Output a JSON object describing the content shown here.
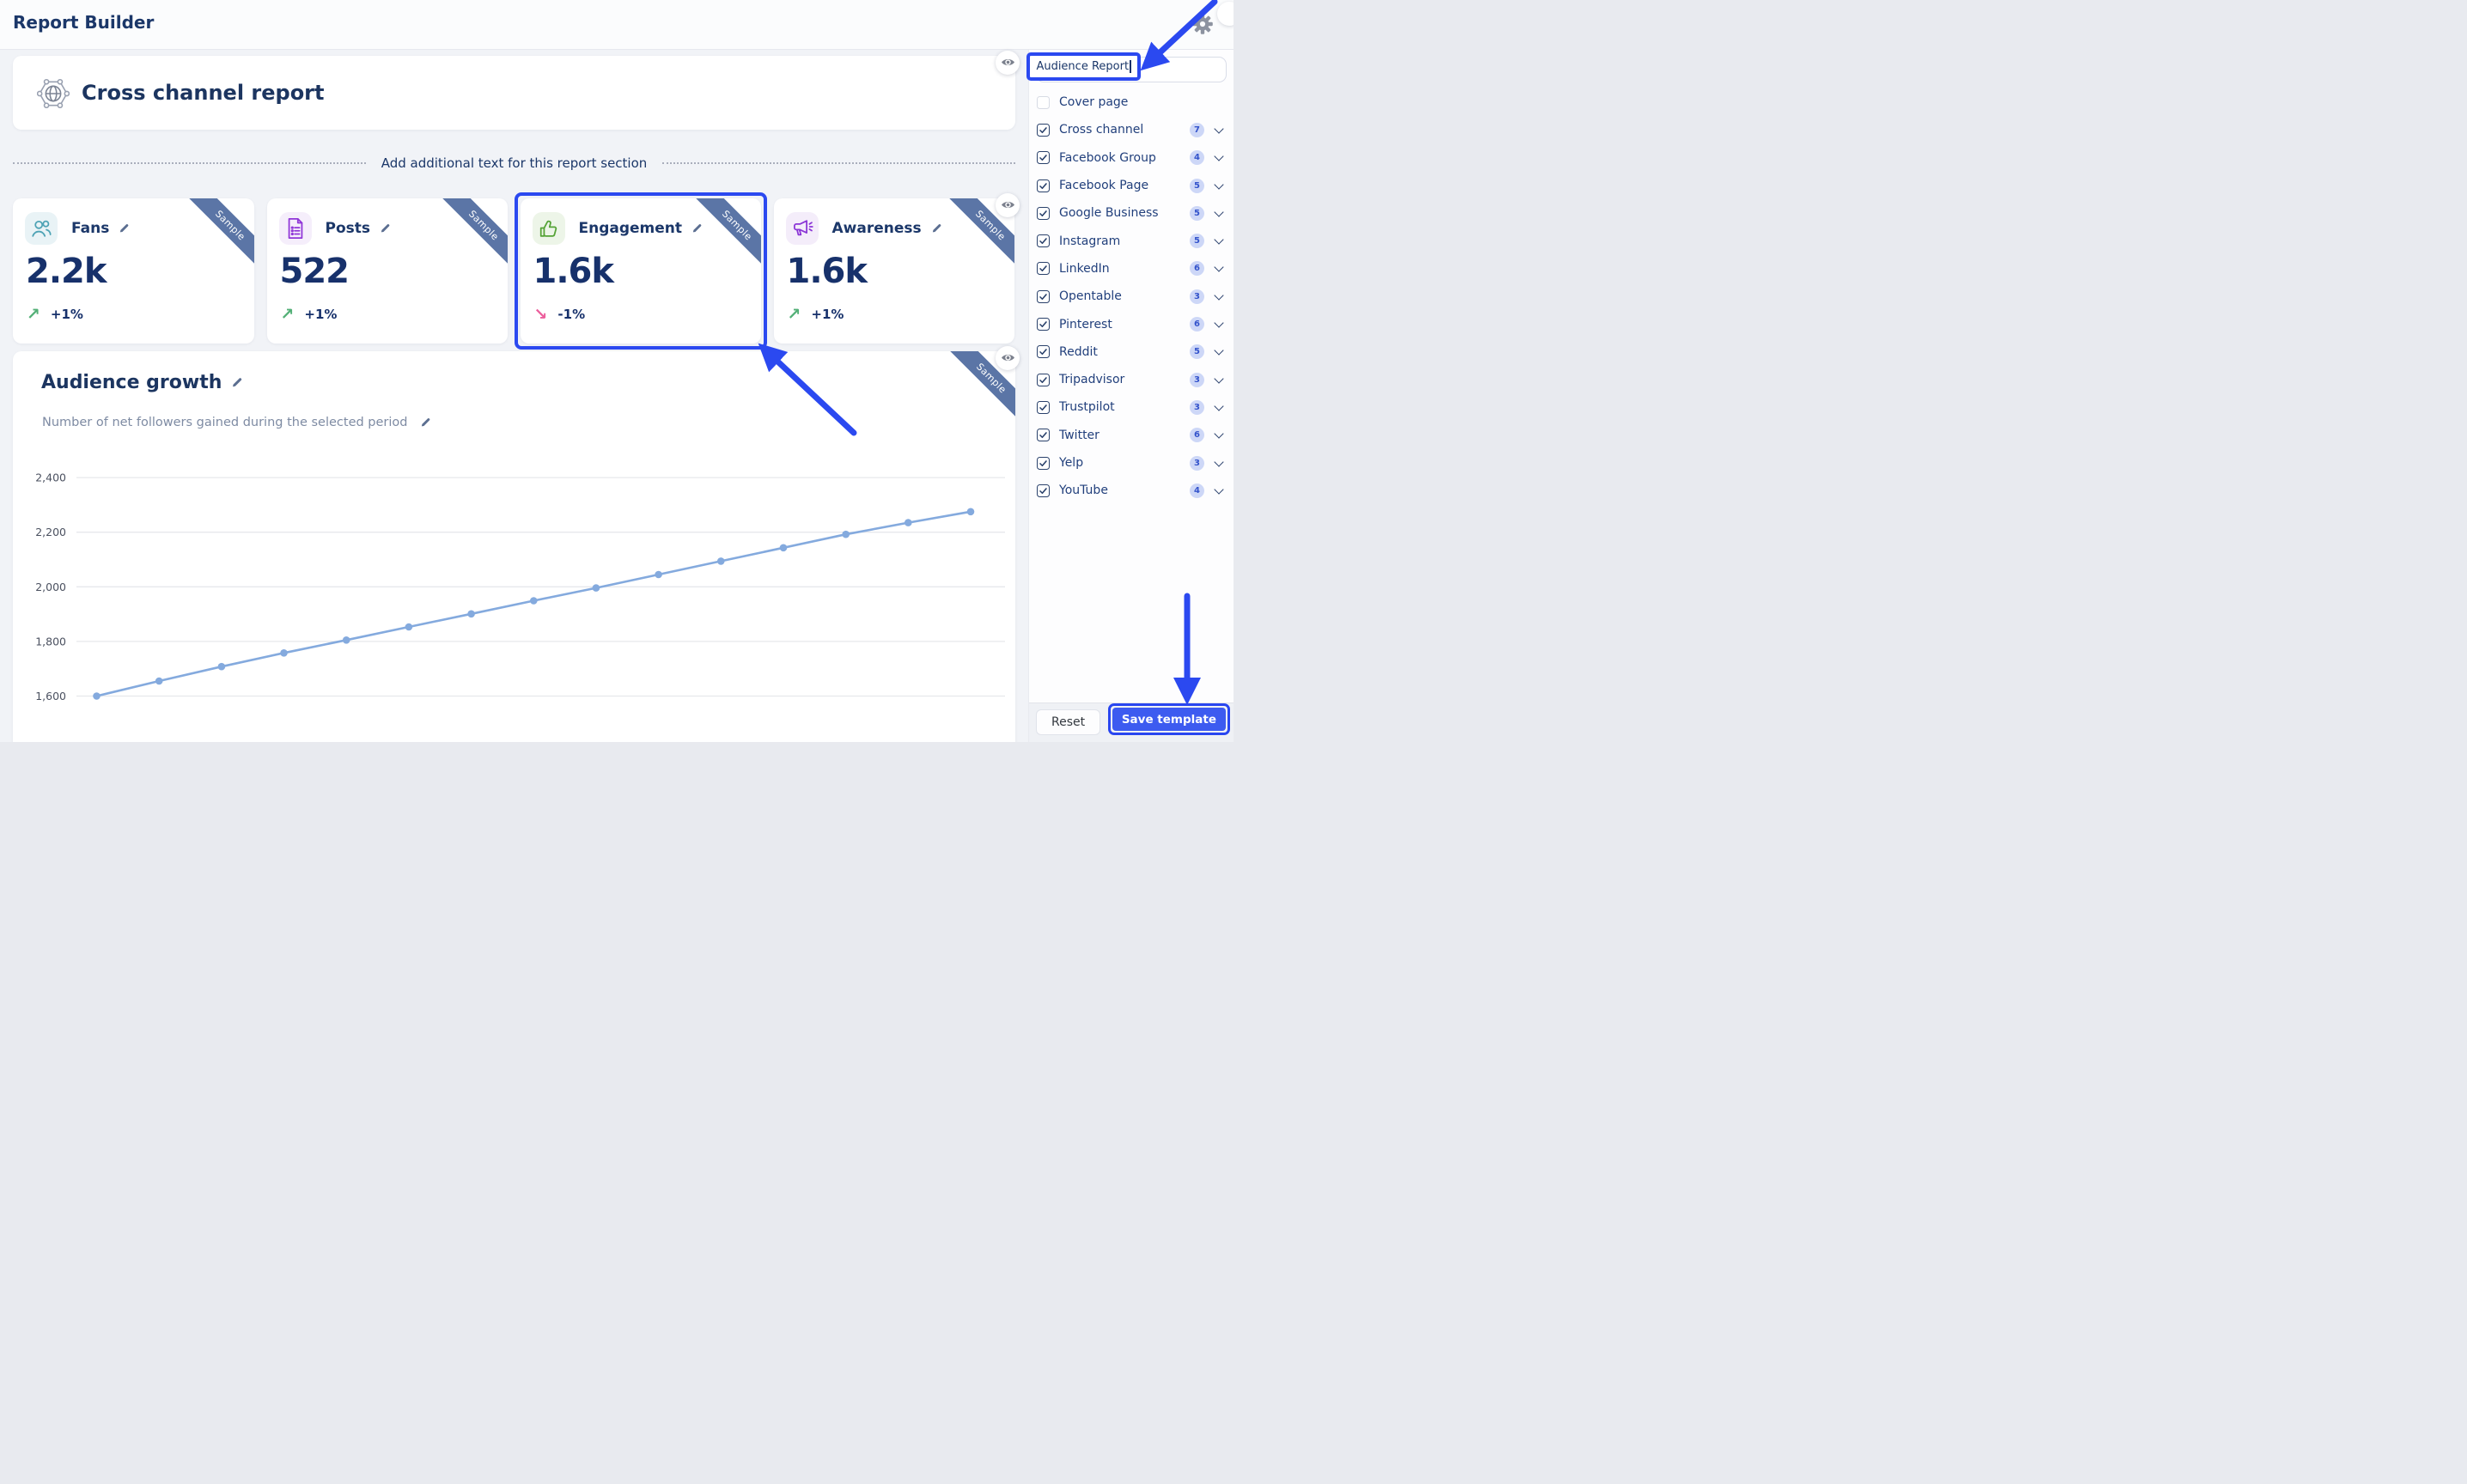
{
  "app": {
    "title": "Report Builder"
  },
  "report": {
    "section_title": "Cross channel report",
    "divider_text": "Add additional text for this report section",
    "sample_badge": "Sample",
    "metrics": [
      {
        "id": "fans",
        "label": "Fans",
        "value": "2.2k",
        "trend": "+1%",
        "direction": "up",
        "icon": "people-icon",
        "icon_color": "#4EA3B5",
        "icon_bg": "#E9F3F6",
        "highlighted": false
      },
      {
        "id": "posts",
        "label": "Posts",
        "value": "522",
        "trend": "+1%",
        "direction": "up",
        "icon": "document-icon",
        "icon_color": "#9036D8",
        "icon_bg": "#F5EEFB",
        "highlighted": false
      },
      {
        "id": "engagement",
        "label": "Engagement",
        "value": "1.6k",
        "trend": "-1%",
        "direction": "down",
        "icon": "thumbs-up-icon",
        "icon_color": "#55A336",
        "icon_bg": "#EDF5E8",
        "highlighted": true
      },
      {
        "id": "awareness",
        "label": "Awareness",
        "value": "1.6k",
        "trend": "+1%",
        "direction": "up",
        "icon": "megaphone-icon",
        "icon_color": "#8B35D6",
        "icon_bg": "#F4EDFA",
        "highlighted": false
      }
    ],
    "chart_section": {
      "title": "Audience growth",
      "subtitle": "Number of net followers gained during the selected period"
    }
  },
  "chart_data": {
    "type": "line",
    "title": "Audience growth",
    "x": [
      1,
      2,
      3,
      4,
      5,
      6,
      7,
      8,
      9,
      10,
      11,
      12,
      13,
      14,
      15
    ],
    "values": [
      1600,
      1655,
      1708,
      1758,
      1805,
      1853,
      1901,
      1949,
      1996,
      2045,
      2094,
      2143,
      2192,
      2235,
      2275
    ],
    "ylim": [
      1600,
      2400
    ],
    "yticks": [
      1600,
      1800,
      2000,
      2200,
      2400
    ],
    "tick_labels": [
      "1,600",
      "1,800",
      "2,000",
      "2,200",
      "2,400"
    ],
    "grid": true,
    "legend": "none",
    "line_color": "#84AADE"
  },
  "trend_colors": {
    "up": "#53B077",
    "down": "#EC5E9C"
  },
  "accent": {
    "annotation_blue": "#2B49F0",
    "ribbon": "#5B75A6",
    "navy": "#1B3769"
  },
  "sidebar": {
    "template_name_input": {
      "value": "Audience Report"
    },
    "items": [
      {
        "label": "Cover page",
        "checked": false,
        "count": null
      },
      {
        "label": "Cross channel",
        "checked": true,
        "count": 7
      },
      {
        "label": "Facebook Group",
        "checked": true,
        "count": 4
      },
      {
        "label": "Facebook Page",
        "checked": true,
        "count": 5
      },
      {
        "label": "Google Business",
        "checked": true,
        "count": 5
      },
      {
        "label": "Instagram",
        "checked": true,
        "count": 5
      },
      {
        "label": "LinkedIn",
        "checked": true,
        "count": 6
      },
      {
        "label": "Opentable",
        "checked": true,
        "count": 3
      },
      {
        "label": "Pinterest",
        "checked": true,
        "count": 6
      },
      {
        "label": "Reddit",
        "checked": true,
        "count": 5
      },
      {
        "label": "Tripadvisor",
        "checked": true,
        "count": 3
      },
      {
        "label": "Trustpilot",
        "checked": true,
        "count": 3
      },
      {
        "label": "Twitter",
        "checked": true,
        "count": 6
      },
      {
        "label": "Yelp",
        "checked": true,
        "count": 3
      },
      {
        "label": "YouTube",
        "checked": true,
        "count": 4
      }
    ],
    "footer": {
      "reset_label": "Reset",
      "save_label": "Save template"
    }
  }
}
